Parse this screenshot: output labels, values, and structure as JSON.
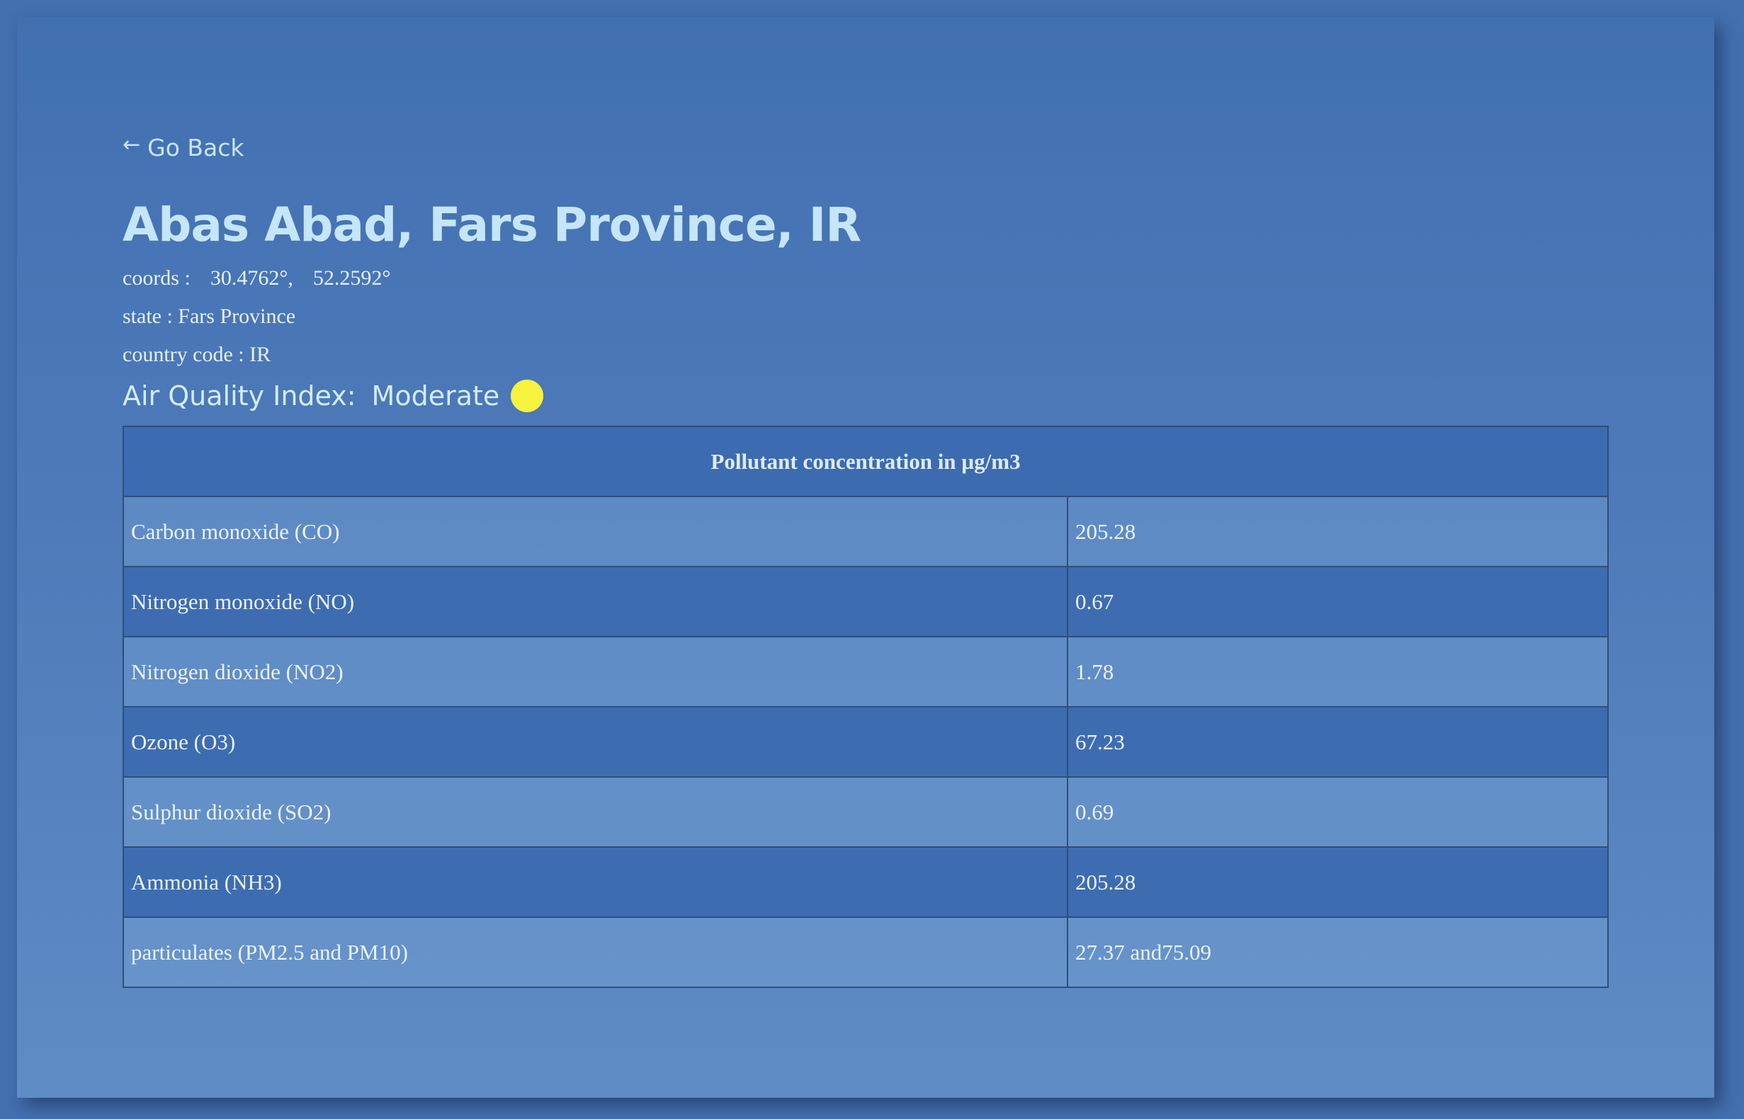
{
  "nav": {
    "back_arrow": "←",
    "back_label": "Go Back"
  },
  "location": {
    "title": "Abas Abad, Fars Province, IR",
    "coords_label": "coords :",
    "latitude": "30.4762°,",
    "longitude": "52.2592°",
    "state_text": "state : Fars Province",
    "country_text": "country code : IR"
  },
  "aqi": {
    "label": "Air Quality Index:",
    "value": "Moderate",
    "color": "#f7f33e"
  },
  "table": {
    "header": "Pollutant concentration in µg/m3",
    "rows": [
      {
        "name": "Carbon monoxide (CO)",
        "value": "205.28"
      },
      {
        "name": "Nitrogen monoxide (NO)",
        "value": "0.67"
      },
      {
        "name": "Nitrogen dioxide (NO2)",
        "value": "1.78"
      },
      {
        "name": "Ozone (O3)",
        "value": "67.23"
      },
      {
        "name": "Sulphur dioxide (SO2)",
        "value": "0.69"
      },
      {
        "name": "Ammonia (NH3)",
        "value": "205.28"
      },
      {
        "name": "particulates (PM2.5 and PM10)",
        "value": "27.37 and75.09"
      }
    ]
  }
}
